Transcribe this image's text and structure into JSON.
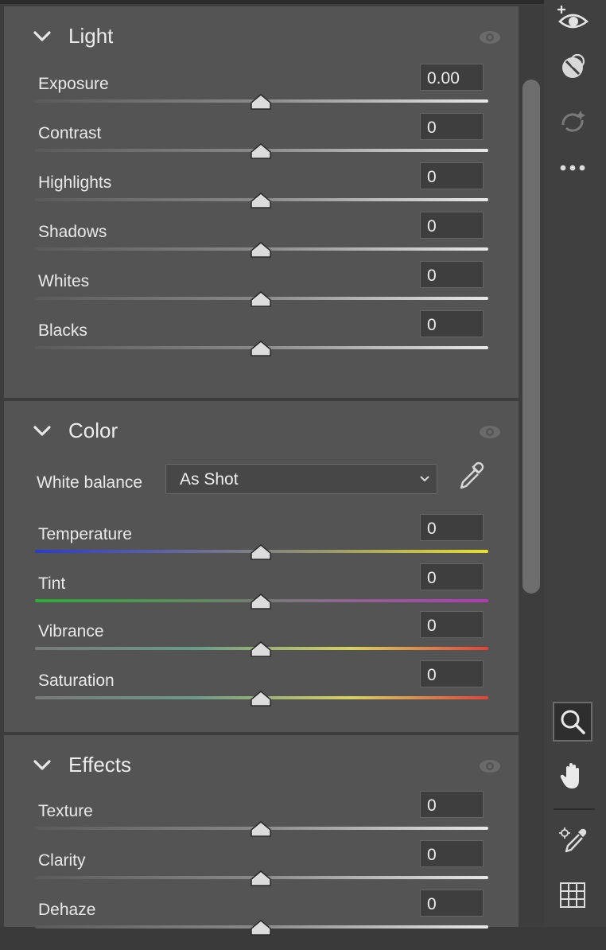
{
  "sections": {
    "light": {
      "title": "Light",
      "sliders": [
        {
          "label": "Exposure",
          "value": "0.00"
        },
        {
          "label": "Contrast",
          "value": "0"
        },
        {
          "label": "Highlights",
          "value": "0"
        },
        {
          "label": "Shadows",
          "value": "0"
        },
        {
          "label": "Whites",
          "value": "0"
        },
        {
          "label": "Blacks",
          "value": "0"
        }
      ]
    },
    "color": {
      "title": "Color",
      "white_balance_label": "White balance",
      "white_balance_value": "As Shot",
      "sliders": [
        {
          "label": "Temperature",
          "value": "0"
        },
        {
          "label": "Tint",
          "value": "0"
        },
        {
          "label": "Vibrance",
          "value": "0"
        },
        {
          "label": "Saturation",
          "value": "0"
        }
      ]
    },
    "effects": {
      "title": "Effects",
      "sliders": [
        {
          "label": "Texture",
          "value": "0"
        },
        {
          "label": "Clarity",
          "value": "0"
        },
        {
          "label": "Dehaze",
          "value": "0"
        }
      ]
    }
  },
  "sidebar": {
    "icons": [
      "add-eye-icon",
      "heal-icon",
      "refresh-sparkle-icon",
      "more-icon",
      "zoom-icon",
      "hand-icon",
      "eyedropper-target-icon",
      "grid-icon"
    ],
    "active": "zoom-icon"
  },
  "colors": {
    "panel_bg": "#545454",
    "temperature_start": "#2b3bd0",
    "temperature_end": "#e8e02a",
    "tint_start": "#2faa3a",
    "tint_end": "#b03ab5",
    "saturation_end": "#e0433a"
  }
}
